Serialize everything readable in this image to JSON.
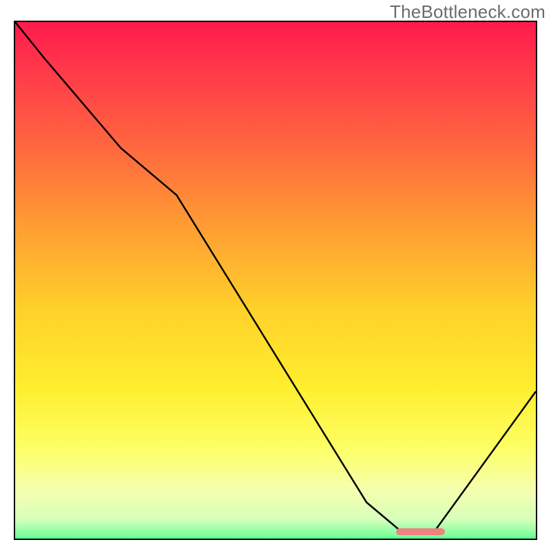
{
  "watermark": "TheBottleneck.com",
  "chart_data": {
    "type": "line",
    "title": "",
    "xlabel": "",
    "ylabel": "",
    "xlim": [
      0,
      100
    ],
    "ylim": [
      0,
      100
    ],
    "grid": false,
    "gradient_stops": [
      {
        "offset": 0.0,
        "color": "#ff1a4b"
      },
      {
        "offset": 0.1,
        "color": "#ff3b4a"
      },
      {
        "offset": 0.25,
        "color": "#ff6a3e"
      },
      {
        "offset": 0.4,
        "color": "#ffa033"
      },
      {
        "offset": 0.55,
        "color": "#ffd02a"
      },
      {
        "offset": 0.7,
        "color": "#ffee2e"
      },
      {
        "offset": 0.82,
        "color": "#fdff66"
      },
      {
        "offset": 0.9,
        "color": "#f4ffb0"
      },
      {
        "offset": 0.955,
        "color": "#d7ffba"
      },
      {
        "offset": 0.985,
        "color": "#7fff9f"
      },
      {
        "offset": 1.0,
        "color": "#2bff86"
      }
    ],
    "series": [
      {
        "name": "bottleneck-curve",
        "x": [
          0.0,
          5.6,
          20.3,
          31.0,
          67.5,
          74.0,
          80.6,
          100.0
        ],
        "y": [
          100.0,
          93.0,
          75.6,
          66.5,
          7.0,
          1.5,
          1.5,
          28.5
        ],
        "stroke": "#000000",
        "stroke_width": 2.5
      }
    ],
    "marker": {
      "name": "optimal-zone",
      "x_start": 73.2,
      "x_end": 82.5,
      "y": 1.3,
      "color": "#e9857e"
    }
  }
}
